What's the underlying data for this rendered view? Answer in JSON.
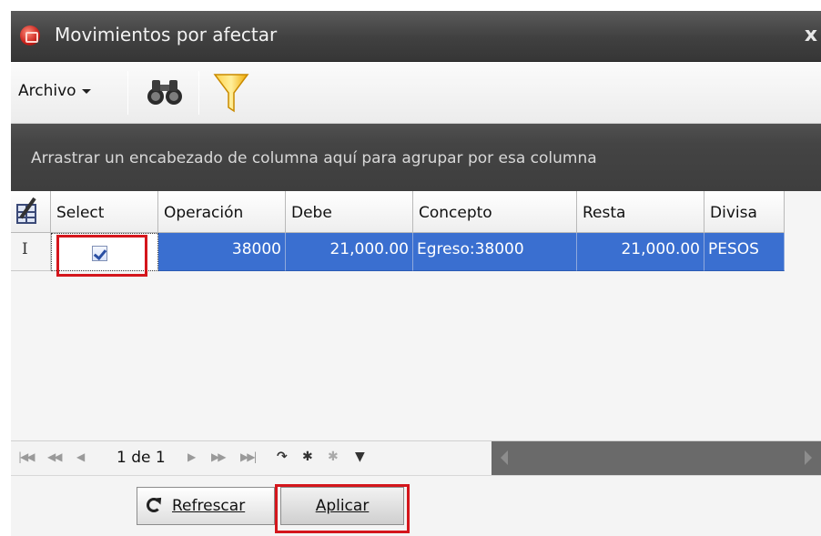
{
  "window": {
    "title": "Movimientos por afectar",
    "close_glyph": "x"
  },
  "toolbar": {
    "archivo_label": "Archivo",
    "icons": [
      "binoculars-icon",
      "filter-funnel-icon"
    ]
  },
  "group_panel": {
    "hint": "Arrastrar un encabezado de columna aquí para agrupar por esa columna"
  },
  "grid": {
    "columns": [
      "Select",
      "Operación",
      "Debe",
      "Concepto",
      "Resta",
      "Divisa"
    ],
    "rows": [
      {
        "indicator": "I",
        "select": true,
        "operacion": "38000",
        "debe": "21,000.00",
        "concepto": "Egreso:38000",
        "resta": "21,000.00",
        "divisa": "PESOS"
      }
    ]
  },
  "navigator": {
    "position": "1 de 1"
  },
  "buttons": {
    "refrescar": "Refrescar",
    "aplicar": "Aplicar"
  },
  "colors": {
    "selection": "#3a6fd0",
    "highlight_box": "#d4161c",
    "titlebar": "#404040"
  }
}
